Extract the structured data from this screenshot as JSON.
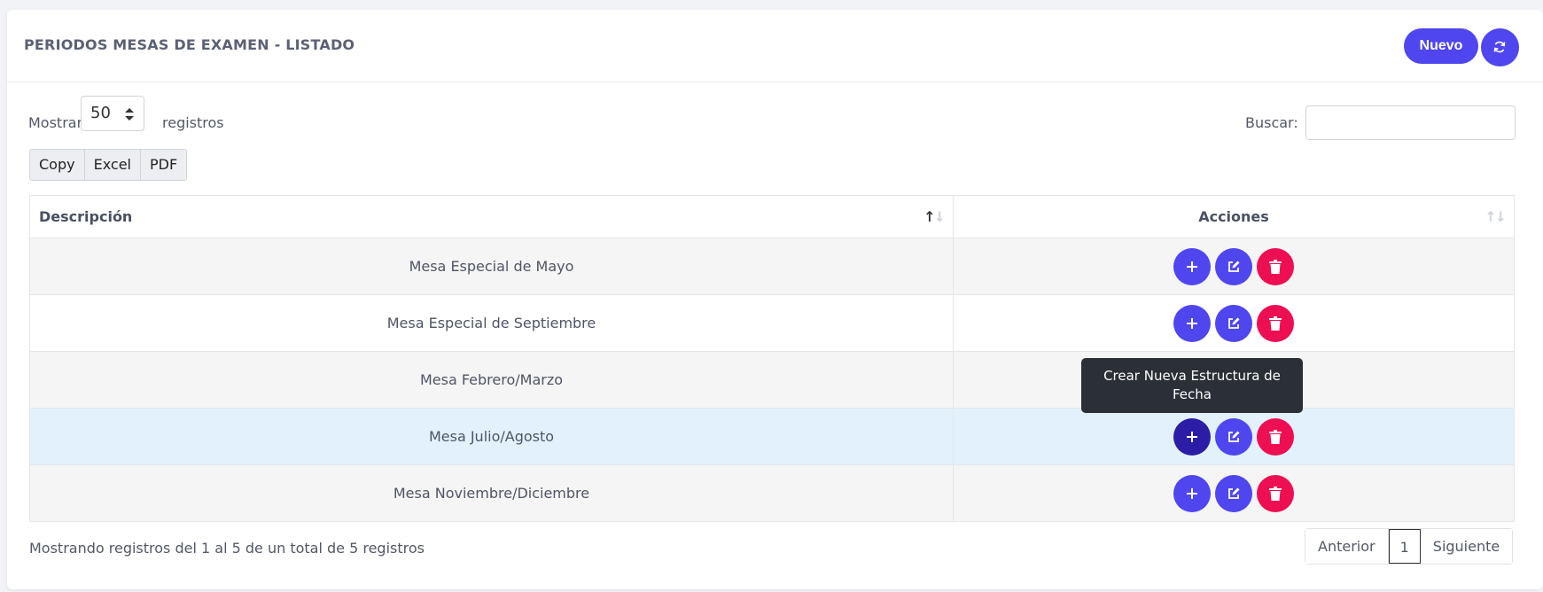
{
  "header": {
    "title": "PERIODOS MESAS DE EXAMEN - LISTADO",
    "new_label": "Nuevo",
    "refresh_icon": "refresh-icon"
  },
  "length": {
    "prefix": "Mostrar",
    "value": "50",
    "suffix": "registros"
  },
  "search": {
    "label": "Buscar:",
    "value": ""
  },
  "export_buttons": [
    "Copy",
    "Excel",
    "PDF"
  ],
  "table": {
    "columns": [
      "Descripción",
      "Acciones"
    ],
    "rows": [
      {
        "descripcion": "Mesa Especial de Mayo"
      },
      {
        "descripcion": "Mesa Especial de Septiembre"
      },
      {
        "descripcion": "Mesa Febrero/Marzo"
      },
      {
        "descripcion": "Mesa Julio/Agosto"
      },
      {
        "descripcion": "Mesa Noviembre/Diciembre"
      }
    ]
  },
  "tooltip": {
    "text": "Crear Nueva Estructura de Fecha"
  },
  "footer": {
    "info": "Mostrando registros del 1 al 5 de un total de 5 registros"
  },
  "pagination": {
    "prev": "Anterior",
    "current": "1",
    "next": "Siguiente"
  },
  "colors": {
    "primary": "#4f46ef",
    "primary_active": "#2b1da6",
    "danger": "#ee0e52",
    "highlight_row": "#e3f1fd"
  }
}
